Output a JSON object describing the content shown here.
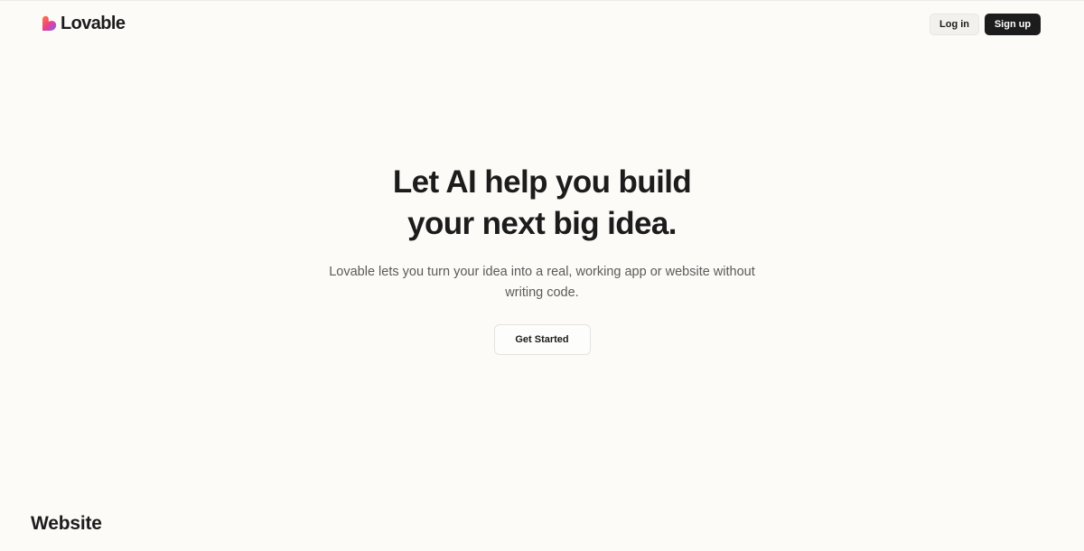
{
  "brand": {
    "name": "Lovable",
    "logo_icon": "lovable-heart-icon",
    "logo_colors": [
      "#ff7a3d",
      "#e9408a",
      "#8b5cf6"
    ]
  },
  "nav": {
    "login_label": "Log in",
    "signup_label": "Sign up"
  },
  "hero": {
    "title_lines": [
      "Let AI help you build",
      "your next big idea."
    ],
    "subtitle": "Lovable lets you turn your idea into a real, working app or website without writing code.",
    "cta_label": "Get Started"
  },
  "section": {
    "heading": "Website"
  },
  "colors": {
    "background": "#fcfbf8",
    "text": "#1c1c1c",
    "muted_text": "#5b5b5b",
    "primary_button": "#1c1c1c"
  }
}
